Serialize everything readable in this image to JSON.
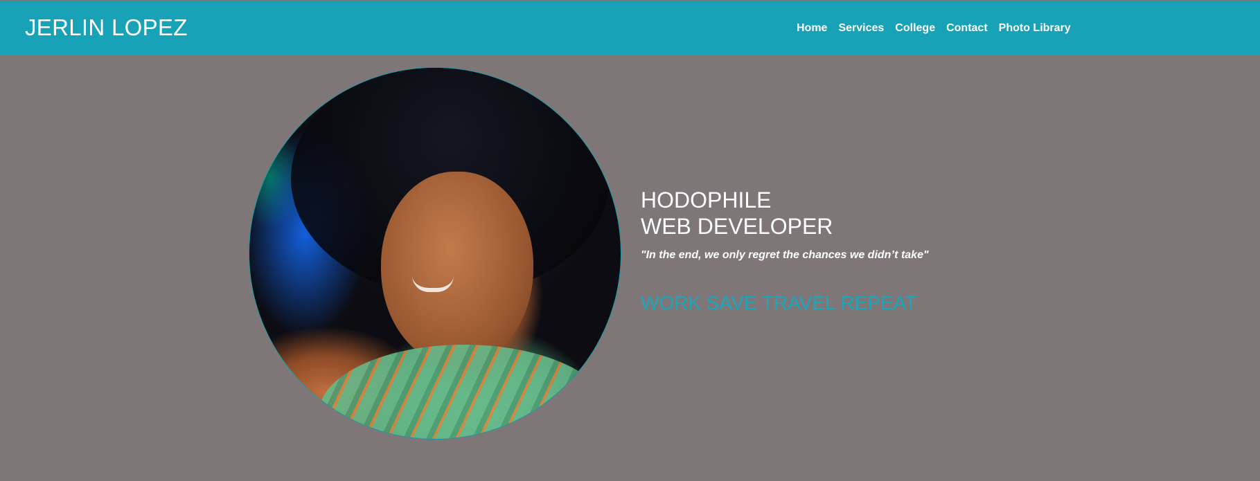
{
  "header": {
    "brand": "JERLIN LOPEZ",
    "nav": [
      {
        "label": "Home"
      },
      {
        "label": "Services"
      },
      {
        "label": "College"
      },
      {
        "label": "Contact"
      },
      {
        "label": "Photo Library"
      }
    ]
  },
  "hero": {
    "headline_line1": "HODOPHILE",
    "headline_line2": "WEB DEVELOPER",
    "quote": "\"In the end, we only regret the chances we didn’t take\"",
    "motto": "WORK SAVE TRAVEL REPEAT",
    "photo_alt": "Portrait photo"
  },
  "colors": {
    "header_bg": "#18a2b8",
    "page_bg": "#7f7777",
    "accent": "#1aa6bb",
    "text": "#ffffff"
  }
}
